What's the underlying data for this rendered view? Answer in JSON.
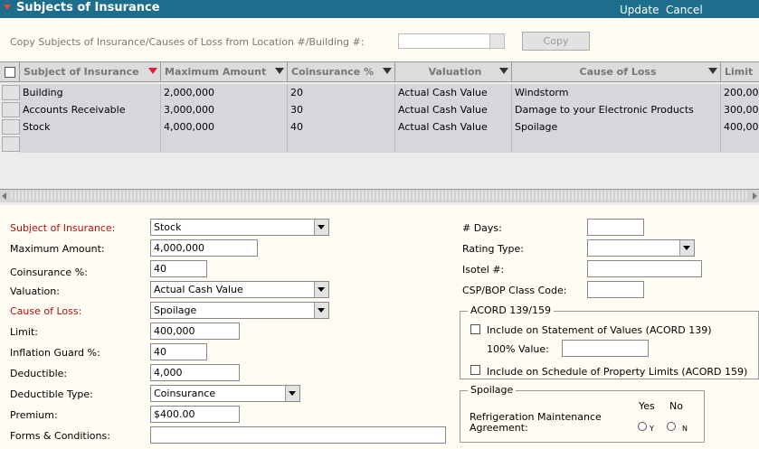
{
  "header": {
    "title": "Subjects of Insurance",
    "update": "Update",
    "cancel": "Cancel"
  },
  "copy": {
    "label": "Copy Subjects of Insurance/Causes of Loss from Location #/Building #:",
    "select_value": "",
    "button": "Copy"
  },
  "grid": {
    "columns": [
      "Subject of Insurance",
      "Maximum Amount",
      "Coinsurance %",
      "Valuation",
      "Cause of Loss",
      "Limit"
    ],
    "rows": [
      [
        "Building",
        "2,000,000",
        "20",
        "Actual Cash Value",
        "Windstorm",
        "200,00"
      ],
      [
        "Accounts Receivable",
        "3,000,000",
        "30",
        "Actual Cash Value",
        "Damage to your Electronic Products",
        "300,00"
      ],
      [
        "Stock",
        "4,000,000",
        "40",
        "Actual Cash Value",
        "Spoilage",
        "400,00"
      ]
    ]
  },
  "form": {
    "subject_label": "Subject of Insurance:",
    "subject_value": "Stock",
    "max_label": "Maximum Amount:",
    "max_value": "4,000,000",
    "coins_label": "Coinsurance %:",
    "coins_value": "40",
    "valuation_label": "Valuation:",
    "valuation_value": "Actual Cash Value",
    "cause_label": "Cause of Loss:",
    "cause_value": "Spoilage",
    "limit_label": "Limit:",
    "limit_value": "400,000",
    "inflation_label": "Inflation Guard %:",
    "inflation_value": "40",
    "deductible_label": "Deductible:",
    "deductible_value": "4,000",
    "deduct_type_label": "Deductible Type:",
    "deduct_type_value": "Coinsurance",
    "premium_label": "Premium:",
    "premium_value": "$400.00",
    "forms_label": "Forms & Conditions:",
    "forms_value": "",
    "days_label": "# Days:",
    "days_value": "",
    "rating_label": "Rating Type:",
    "rating_value": "",
    "isotel_label": "Isotel #:",
    "isotel_value": "",
    "csp_label": "CSP/BOP Class Code:",
    "csp_value": ""
  },
  "acord": {
    "legend": "ACORD 139/159",
    "include139": "Include on Statement of Values (ACORD 139)",
    "value100_label": "100% Value:",
    "value100": "",
    "include159": "Include on Schedule of Property Limits (ACORD 159)"
  },
  "spoilage": {
    "legend": "Spoilage",
    "yes": "Yes",
    "no": "No",
    "agreement_line1": "Refrigeration Maintenance",
    "agreement_line2": "Agreement:",
    "y": "Y",
    "n": "N"
  },
  "colors": {
    "title_bar": "#1c6e8c",
    "required_label": "#b01010",
    "grid_row": "#d7d6dc"
  }
}
